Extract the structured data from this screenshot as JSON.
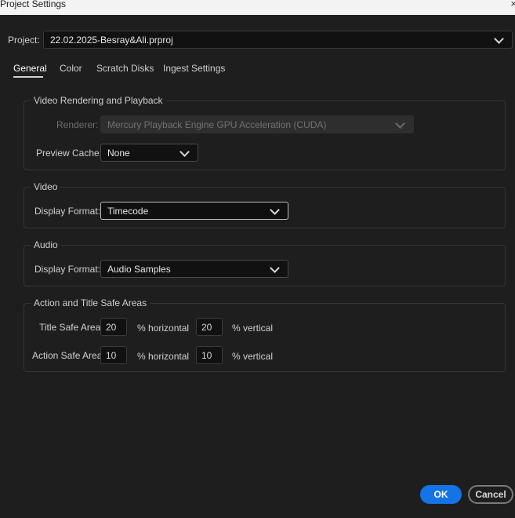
{
  "window": {
    "title": "Project Settings",
    "close_glyph": "×"
  },
  "project": {
    "label": "Project:",
    "value": "22.02.2025-Besray&Ali.prproj"
  },
  "tabs": [
    {
      "label": "General"
    },
    {
      "label": "Color"
    },
    {
      "label": "Scratch Disks"
    },
    {
      "label": "Ingest Settings"
    }
  ],
  "video_rendering": {
    "title": "Video Rendering and Playback",
    "renderer_label": "Renderer:",
    "renderer_value": "Mercury Playback Engine GPU Acceleration (CUDA)",
    "preview_cache_label": "Preview Cache:",
    "preview_cache_value": "None"
  },
  "video": {
    "title": "Video",
    "display_format_label": "Display Format:",
    "display_format_value": "Timecode"
  },
  "audio": {
    "title": "Audio",
    "display_format_label": "Display Format:",
    "display_format_value": "Audio Samples"
  },
  "safe_areas": {
    "title": "Action and Title Safe Areas",
    "title_safe_label": "Title Safe Area",
    "title_safe_horizontal": "20",
    "title_safe_vertical": "20",
    "action_safe_label": "Action Safe Area",
    "action_safe_horizontal": "10",
    "action_safe_vertical": "10",
    "horizontal_suffix": "% horizontal",
    "vertical_suffix": "% vertical"
  },
  "buttons": {
    "ok": "OK",
    "cancel": "Cancel"
  },
  "colors": {
    "accent": "#1473e6",
    "background": "#1e1e1e"
  }
}
